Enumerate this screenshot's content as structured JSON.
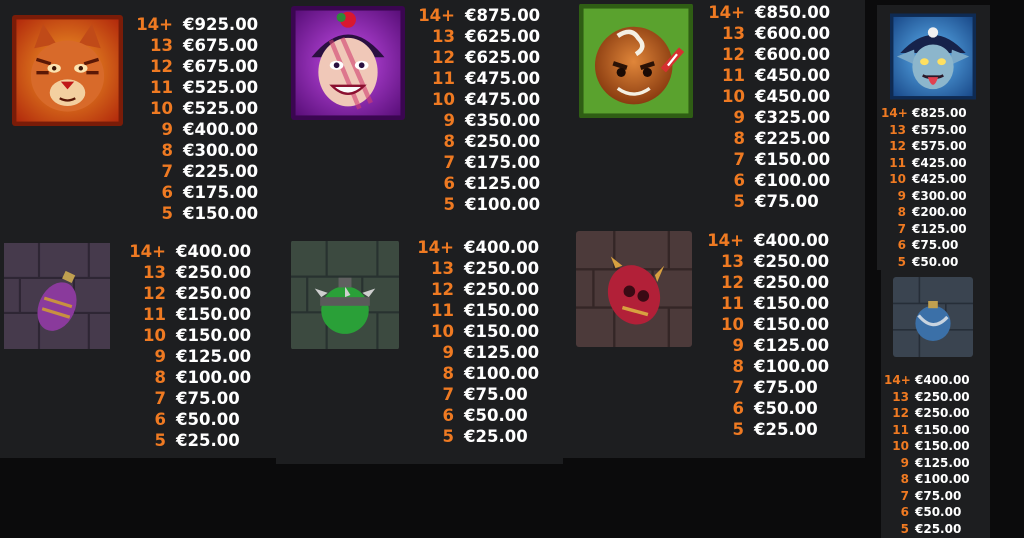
{
  "paytables": {
    "tiger": {
      "symbol": "tiger-icon",
      "frame_color": "#e8561c",
      "rows": [
        {
          "count": "14+",
          "amount": "€925.00"
        },
        {
          "count": "13",
          "amount": "€675.00"
        },
        {
          "count": "12",
          "amount": "€675.00"
        },
        {
          "count": "11",
          "amount": "€525.00"
        },
        {
          "count": "10",
          "amount": "€525.00"
        },
        {
          "count": "9",
          "amount": "€400.00"
        },
        {
          "count": "8",
          "amount": "€300.00"
        },
        {
          "count": "7",
          "amount": "€225.00"
        },
        {
          "count": "6",
          "amount": "€175.00"
        },
        {
          "count": "5",
          "amount": "€150.00"
        }
      ]
    },
    "jester": {
      "symbol": "jester-icon",
      "frame_color": "#b32bd6",
      "rows": [
        {
          "count": "14+",
          "amount": "€875.00"
        },
        {
          "count": "13",
          "amount": "€625.00"
        },
        {
          "count": "12",
          "amount": "€625.00"
        },
        {
          "count": "11",
          "amount": "€475.00"
        },
        {
          "count": "10",
          "amount": "€475.00"
        },
        {
          "count": "9",
          "amount": "€350.00"
        },
        {
          "count": "8",
          "amount": "€250.00"
        },
        {
          "count": "7",
          "amount": "€175.00"
        },
        {
          "count": "6",
          "amount": "€125.00"
        },
        {
          "count": "5",
          "amount": "€100.00"
        }
      ]
    },
    "gingerbread": {
      "symbol": "gingerbread-icon",
      "frame_color": "#6ab33a",
      "rows": [
        {
          "count": "14+",
          "amount": "€850.00"
        },
        {
          "count": "13",
          "amount": "€600.00"
        },
        {
          "count": "12",
          "amount": "€600.00"
        },
        {
          "count": "11",
          "amount": "€450.00"
        },
        {
          "count": "10",
          "amount": "€450.00"
        },
        {
          "count": "9",
          "amount": "€325.00"
        },
        {
          "count": "8",
          "amount": "€225.00"
        },
        {
          "count": "7",
          "amount": "€150.00"
        },
        {
          "count": "6",
          "amount": "€100.00"
        },
        {
          "count": "5",
          "amount": "€75.00"
        }
      ]
    },
    "goblin": {
      "symbol": "goblin-icon",
      "frame_color": "#3c8fd8",
      "rows": [
        {
          "count": "14+",
          "amount": "€825.00"
        },
        {
          "count": "13",
          "amount": "€575.00"
        },
        {
          "count": "12",
          "amount": "€575.00"
        },
        {
          "count": "11",
          "amount": "€425.00"
        },
        {
          "count": "10",
          "amount": "€425.00"
        },
        {
          "count": "9",
          "amount": "€300.00"
        },
        {
          "count": "8",
          "amount": "€200.00"
        },
        {
          "count": "7",
          "amount": "€125.00"
        },
        {
          "count": "6",
          "amount": "€75.00"
        },
        {
          "count": "5",
          "amount": "€50.00"
        }
      ]
    },
    "purple_ornament": {
      "symbol": "purple-ornament-icon",
      "rows": [
        {
          "count": "14+",
          "amount": "€400.00"
        },
        {
          "count": "13",
          "amount": "€250.00"
        },
        {
          "count": "12",
          "amount": "€250.00"
        },
        {
          "count": "11",
          "amount": "€150.00"
        },
        {
          "count": "10",
          "amount": "€150.00"
        },
        {
          "count": "9",
          "amount": "€125.00"
        },
        {
          "count": "8",
          "amount": "€100.00"
        },
        {
          "count": "7",
          "amount": "€75.00"
        },
        {
          "count": "6",
          "amount": "€50.00"
        },
        {
          "count": "5",
          "amount": "€25.00"
        }
      ]
    },
    "green_ornament": {
      "symbol": "green-spiked-ornament-icon",
      "rows": [
        {
          "count": "14+",
          "amount": "€400.00"
        },
        {
          "count": "13",
          "amount": "€250.00"
        },
        {
          "count": "12",
          "amount": "€250.00"
        },
        {
          "count": "11",
          "amount": "€150.00"
        },
        {
          "count": "10",
          "amount": "€150.00"
        },
        {
          "count": "9",
          "amount": "€125.00"
        },
        {
          "count": "8",
          "amount": "€100.00"
        },
        {
          "count": "7",
          "amount": "€75.00"
        },
        {
          "count": "6",
          "amount": "€50.00"
        },
        {
          "count": "5",
          "amount": "€25.00"
        }
      ]
    },
    "red_ornament": {
      "symbol": "red-skull-ornament-icon",
      "rows": [
        {
          "count": "14+",
          "amount": "€400.00"
        },
        {
          "count": "13",
          "amount": "€250.00"
        },
        {
          "count": "12",
          "amount": "€250.00"
        },
        {
          "count": "11",
          "amount": "€150.00"
        },
        {
          "count": "10",
          "amount": "€150.00"
        },
        {
          "count": "9",
          "amount": "€125.00"
        },
        {
          "count": "8",
          "amount": "€100.00"
        },
        {
          "count": "7",
          "amount": "€75.00"
        },
        {
          "count": "6",
          "amount": "€50.00"
        },
        {
          "count": "5",
          "amount": "€25.00"
        }
      ]
    },
    "blue_ornament": {
      "symbol": "blue-ornament-icon",
      "rows": [
        {
          "count": "14+",
          "amount": "€400.00"
        },
        {
          "count": "13",
          "amount": "€250.00"
        },
        {
          "count": "12",
          "amount": "€250.00"
        },
        {
          "count": "11",
          "amount": "€150.00"
        },
        {
          "count": "10",
          "amount": "€150.00"
        },
        {
          "count": "9",
          "amount": "€125.00"
        },
        {
          "count": "8",
          "amount": "€100.00"
        },
        {
          "count": "7",
          "amount": "€75.00"
        },
        {
          "count": "6",
          "amount": "€50.00"
        },
        {
          "count": "5",
          "amount": "€25.00"
        }
      ]
    }
  }
}
